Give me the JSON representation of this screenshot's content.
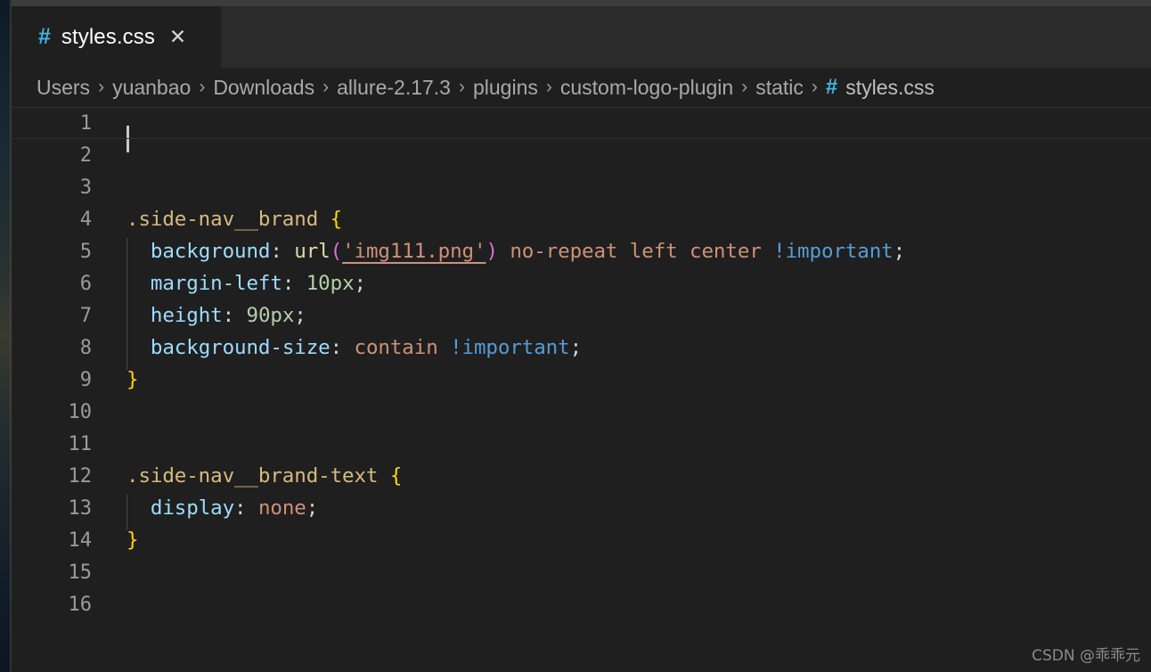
{
  "tab": {
    "icon": "css-file-hash-icon",
    "title": "styles.css",
    "close_glyph": "✕"
  },
  "breadcrumb": {
    "separator": "›",
    "items": [
      "Users",
      "yuanbao",
      "Downloads",
      "allure-2.17.3",
      "plugins",
      "custom-logo-plugin",
      "static"
    ],
    "file": {
      "icon": "#",
      "label": "styles.css"
    }
  },
  "editor": {
    "language": "css",
    "active_line": 1,
    "cursor_column": 1,
    "line_numbers": [
      "1",
      "2",
      "3",
      "4",
      "5",
      "6",
      "7",
      "8",
      "9",
      "10",
      "11",
      "12",
      "13",
      "14",
      "15",
      "16"
    ],
    "lines": [
      {
        "n": "1",
        "tokens": []
      },
      {
        "n": "2",
        "tokens": []
      },
      {
        "n": "3",
        "tokens": []
      },
      {
        "n": "4",
        "tokens": [
          {
            "t": ".side-nav__brand ",
            "c": "t-sel"
          },
          {
            "t": "{",
            "c": "t-brace"
          }
        ]
      },
      {
        "n": "5",
        "tokens": [
          {
            "t": "  ",
            "c": "t-punc"
          },
          {
            "t": "background",
            "c": "t-prop"
          },
          {
            "t": ": ",
            "c": "t-punc"
          },
          {
            "t": "url",
            "c": "t-fn"
          },
          {
            "t": "(",
            "c": "t-paren"
          },
          {
            "t": "'img111.png'",
            "c": "t-str"
          },
          {
            "t": ")",
            "c": "t-paren"
          },
          {
            "t": " no-repeat left center ",
            "c": "t-val"
          },
          {
            "t": "!important",
            "c": "t-imp"
          },
          {
            "t": ";",
            "c": "t-punc"
          }
        ]
      },
      {
        "n": "6",
        "tokens": [
          {
            "t": "  ",
            "c": "t-punc"
          },
          {
            "t": "margin-left",
            "c": "t-prop"
          },
          {
            "t": ": ",
            "c": "t-punc"
          },
          {
            "t": "10px",
            "c": "t-num"
          },
          {
            "t": ";",
            "c": "t-punc"
          }
        ]
      },
      {
        "n": "7",
        "tokens": [
          {
            "t": "  ",
            "c": "t-punc"
          },
          {
            "t": "height",
            "c": "t-prop"
          },
          {
            "t": ": ",
            "c": "t-punc"
          },
          {
            "t": "90px",
            "c": "t-num"
          },
          {
            "t": ";",
            "c": "t-punc"
          }
        ]
      },
      {
        "n": "8",
        "tokens": [
          {
            "t": "  ",
            "c": "t-punc"
          },
          {
            "t": "background-size",
            "c": "t-prop"
          },
          {
            "t": ": ",
            "c": "t-punc"
          },
          {
            "t": "contain ",
            "c": "t-val"
          },
          {
            "t": "!important",
            "c": "t-imp"
          },
          {
            "t": ";",
            "c": "t-punc"
          }
        ]
      },
      {
        "n": "9",
        "tokens": [
          {
            "t": "}",
            "c": "t-brace"
          }
        ]
      },
      {
        "n": "10",
        "tokens": []
      },
      {
        "n": "11",
        "tokens": []
      },
      {
        "n": "12",
        "tokens": [
          {
            "t": ".side-nav__brand-text ",
            "c": "t-sel"
          },
          {
            "t": "{",
            "c": "t-brace"
          }
        ]
      },
      {
        "n": "13",
        "tokens": [
          {
            "t": "  ",
            "c": "t-punc"
          },
          {
            "t": "display",
            "c": "t-prop"
          },
          {
            "t": ": ",
            "c": "t-punc"
          },
          {
            "t": "none",
            "c": "t-val"
          },
          {
            "t": ";",
            "c": "t-punc"
          }
        ]
      },
      {
        "n": "14",
        "tokens": [
          {
            "t": "}",
            "c": "t-brace"
          }
        ]
      },
      {
        "n": "15",
        "tokens": []
      },
      {
        "n": "16",
        "tokens": []
      }
    ],
    "indent_guide_lines": [
      "5",
      "6",
      "7",
      "8",
      "13"
    ]
  },
  "watermark": {
    "text": "CSDN @乖乖元"
  },
  "colors": {
    "editor_background": "#1f1f1f",
    "tabbar_background": "#2b2b2b",
    "titlebar_strip": "#3c3c3c",
    "line_number": "#9b9b9b",
    "selector": "#d7ba7d",
    "brace": "#ffd700",
    "property": "#9cdcfe",
    "function": "#dcdcaa",
    "paren": "#da70d6",
    "string": "#ce9178",
    "value": "#ce9178",
    "important": "#569cd6",
    "number": "#b5cea8",
    "css_icon": "#41b6e6"
  }
}
